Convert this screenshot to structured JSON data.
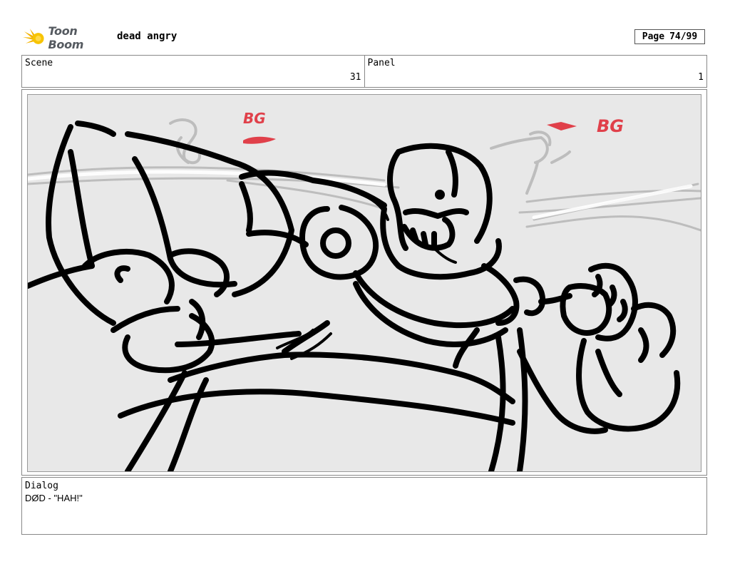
{
  "header": {
    "logo_text": "Toon Boom",
    "project_title": "dead angry",
    "page_label": "Page",
    "page_value": "74/99"
  },
  "scene": {
    "label": "Scene",
    "value": "31"
  },
  "panel": {
    "label": "Panel",
    "value": "1"
  },
  "sketch": {
    "background_color": "#e8e8e8",
    "ink_color": "#000000",
    "note_color": "#e0404a",
    "guide_color": "#bdbdbd",
    "notes": [
      "BG",
      "BG"
    ]
  },
  "dialog": {
    "label": "Dialog",
    "text": "DØD - \"HAH!\""
  }
}
